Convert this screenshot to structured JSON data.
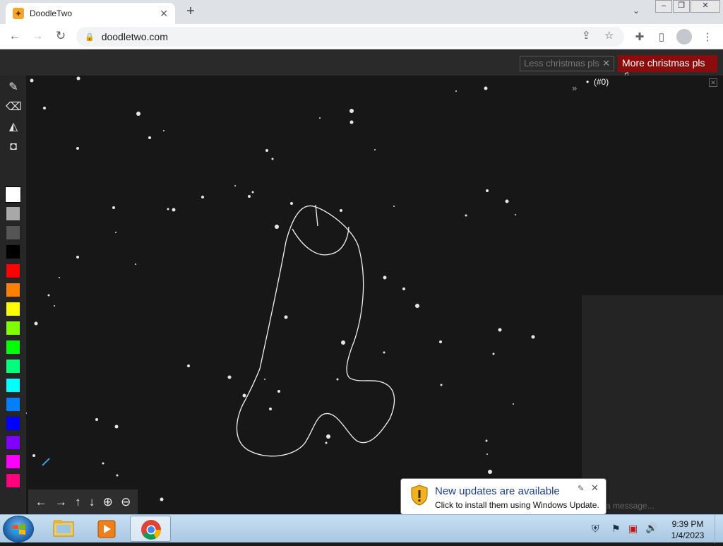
{
  "browser": {
    "tab_title": "DoodleTwo",
    "tab_close": "✕",
    "new_tab": "+",
    "tab_menu": "⌄",
    "url": "doodletwo.com"
  },
  "page": {
    "less_button": "Less christmas pls",
    "less_close": "✕",
    "more_button": "More christmas pls ♫",
    "collapse_label": "»",
    "user_list_item": "(#0)",
    "chat_placeholder": "a message...",
    "colors": [
      "#ffffff",
      "#a8a8a8",
      "#555555",
      "#000000",
      "#ff0000",
      "#ff7f00",
      "#ffff00",
      "#7fff00",
      "#00ff00",
      "#00ff7f",
      "#00ffff",
      "#007fff",
      "#0000ff",
      "#7f00ff",
      "#ff00ff",
      "#ff007f"
    ],
    "selected_color": "#ffffff",
    "tools": [
      "pencil-icon",
      "eraser-icon",
      "fill-bucket-icon",
      "camera-icon"
    ]
  },
  "notification": {
    "title": "New updates are available",
    "message": "Click to install them using Windows Update."
  },
  "taskbar": {
    "time": "9:39 PM",
    "date": "1/4/2023",
    "apps": [
      "windows-explorer",
      "media-player",
      "chrome"
    ]
  }
}
